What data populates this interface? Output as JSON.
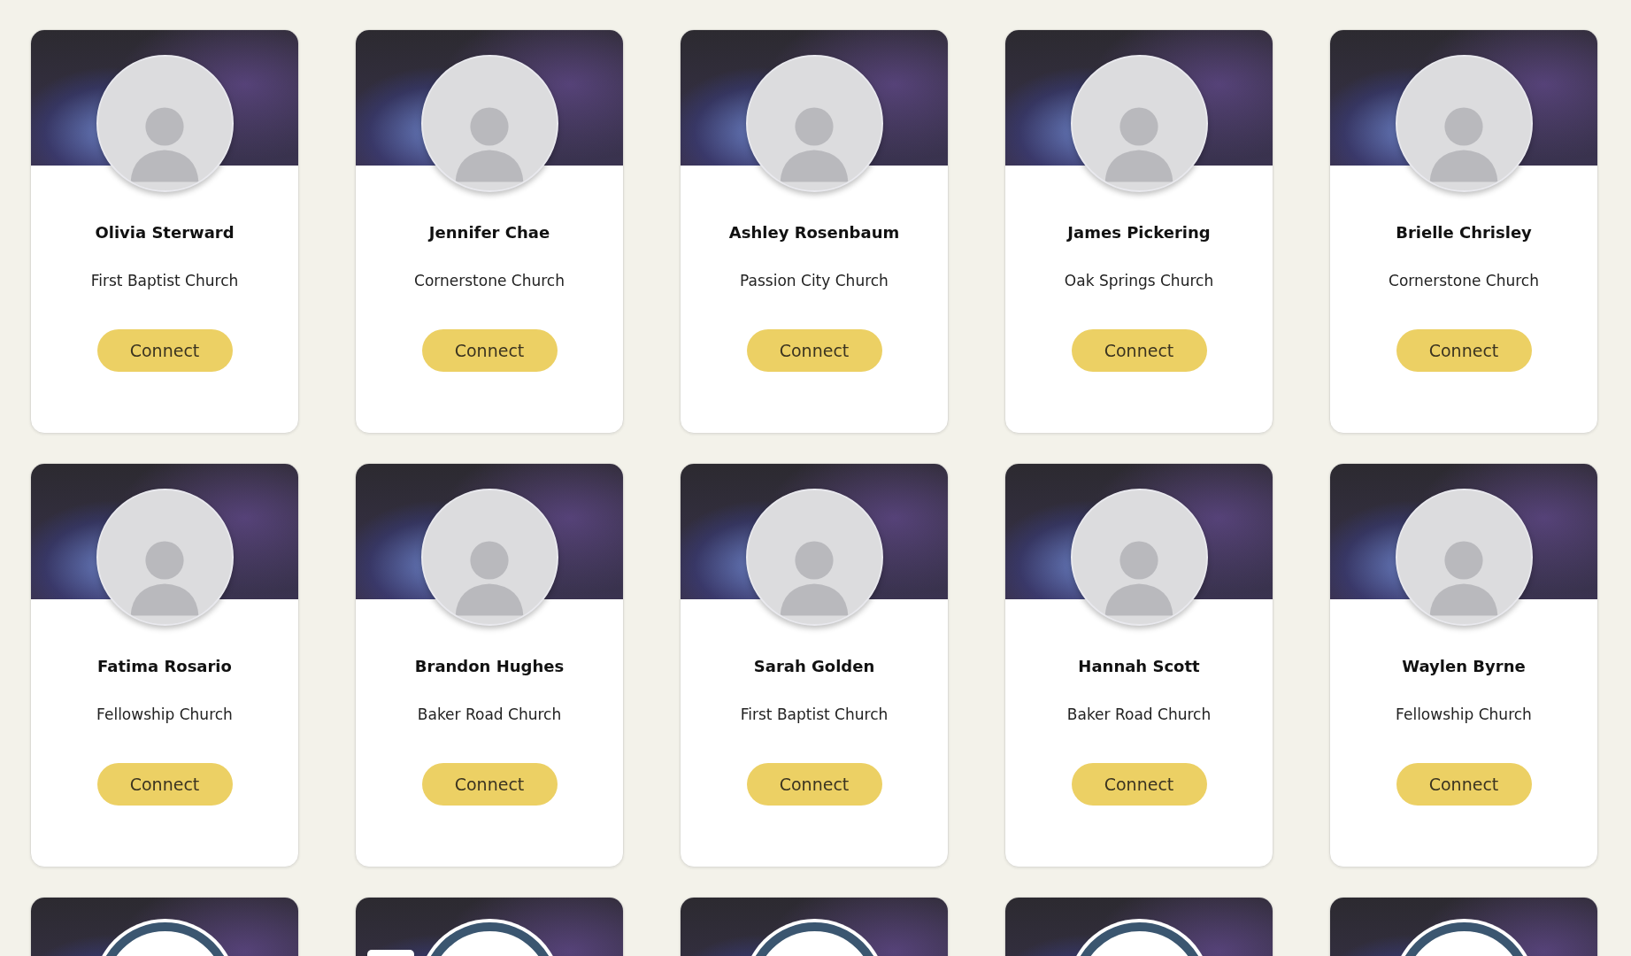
{
  "cards": [
    {
      "kind": "profile",
      "name": "Olivia Sterward",
      "church": "First Baptist Church",
      "button": "Connect"
    },
    {
      "kind": "profile",
      "name": "Jennifer Chae",
      "church": "Cornerstone Church",
      "button": "Connect"
    },
    {
      "kind": "profile",
      "name": "Ashley Rosenbaum",
      "church": "Passion City Church",
      "button": "Connect"
    },
    {
      "kind": "profile",
      "name": "James Pickering",
      "church": "Oak Springs Church",
      "button": "Connect"
    },
    {
      "kind": "profile",
      "name": "Brielle Chrisley",
      "church": "Cornerstone Church",
      "button": "Connect"
    },
    {
      "kind": "profile",
      "name": "Fatima Rosario",
      "church": "Fellowship Church",
      "button": "Connect"
    },
    {
      "kind": "profile",
      "name": "Brandon Hughes",
      "church": "Baker Road Church",
      "button": "Connect"
    },
    {
      "kind": "profile",
      "name": "Sarah Golden",
      "church": "First Baptist Church",
      "button": "Connect"
    },
    {
      "kind": "profile",
      "name": "Hannah Scott",
      "church": "Baker Road Church",
      "button": "Connect"
    },
    {
      "kind": "profile",
      "name": "Waylen Byrne",
      "church": "Fellowship Church",
      "button": "Connect"
    },
    {
      "kind": "placeholder",
      "badge": false
    },
    {
      "kind": "placeholder",
      "badge": true
    },
    {
      "kind": "placeholder",
      "badge": false
    },
    {
      "kind": "placeholder",
      "badge": false
    },
    {
      "kind": "placeholder",
      "badge": false
    }
  ]
}
